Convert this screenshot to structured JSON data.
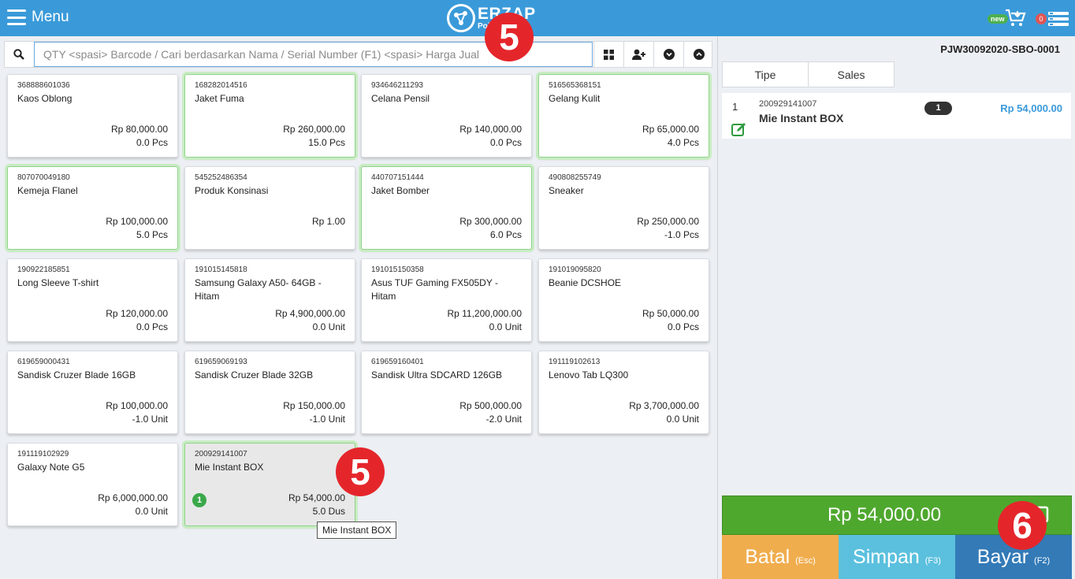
{
  "header": {
    "menu_label": "Menu",
    "brand_name": "ERZAP",
    "brand_sub": "Point of Sales",
    "new_badge": "new",
    "cart_count": "0"
  },
  "search": {
    "placeholder": "QTY <spasi> Barcode / Cari berdasarkan Nama / Serial Number (F1) <spasi> Harga Jual"
  },
  "products": [
    {
      "code": "368888601036",
      "name": "Kaos Oblong",
      "price": "Rp 80,000.00",
      "qty": "0.0 Pcs",
      "state": "normal"
    },
    {
      "code": "168282014516",
      "name": "Jaket Fuma",
      "price": "Rp 260,000.00",
      "qty": "15.0 Pcs",
      "state": "in-stock"
    },
    {
      "code": "934646211293",
      "name": "Celana Pensil",
      "price": "Rp 140,000.00",
      "qty": "0.0 Pcs",
      "state": "normal"
    },
    {
      "code": "516565368151",
      "name": "Gelang Kulit",
      "price": "Rp 65,000.00",
      "qty": "4.0 Pcs",
      "state": "in-stock"
    },
    {
      "code": "807070049180",
      "name": "Kemeja Flanel",
      "price": "Rp 100,000.00",
      "qty": "5.0 Pcs",
      "state": "in-stock"
    },
    {
      "code": "545252486354",
      "name": "Produk Konsinasi",
      "price": "Rp 1.00",
      "qty": "",
      "state": "normal"
    },
    {
      "code": "440707151444",
      "name": "Jaket Bomber",
      "price": "Rp 300,000.00",
      "qty": "6.0 Pcs",
      "state": "in-stock"
    },
    {
      "code": "490808255749",
      "name": "Sneaker",
      "price": "Rp 250,000.00",
      "qty": "-1.0 Pcs",
      "state": "normal"
    },
    {
      "code": "190922185851",
      "name": "Long Sleeve T-shirt",
      "price": "Rp 120,000.00",
      "qty": "0.0 Pcs",
      "state": "normal"
    },
    {
      "code": "191015145818",
      "name": "Samsung Galaxy A50- 64GB - Hitam",
      "price": "Rp 4,900,000.00",
      "qty": "0.0 Unit",
      "state": "normal"
    },
    {
      "code": "191015150358",
      "name": "Asus TUF Gaming FX505DY - Hitam",
      "price": "Rp 11,200,000.00",
      "qty": "0.0 Unit",
      "state": "normal"
    },
    {
      "code": "191019095820",
      "name": "Beanie DCSHOE",
      "price": "Rp 50,000.00",
      "qty": "0.0 Pcs",
      "state": "normal"
    },
    {
      "code": "619659000431",
      "name": "Sandisk Cruzer Blade 16GB",
      "price": "Rp 100,000.00",
      "qty": "-1.0 Unit",
      "state": "normal"
    },
    {
      "code": "619659069193",
      "name": "Sandisk Cruzer Blade 32GB",
      "price": "Rp 150,000.00",
      "qty": "-1.0 Unit",
      "state": "normal"
    },
    {
      "code": "619659160401",
      "name": "Sandisk Ultra SDCARD 126GB",
      "price": "Rp 500,000.00",
      "qty": "-2.0 Unit",
      "state": "normal"
    },
    {
      "code": "191119102613",
      "name": "Lenovo Tab LQ300",
      "price": "Rp 3,700,000.00",
      "qty": "0.0 Unit",
      "state": "normal"
    },
    {
      "code": "191119102929",
      "name": "Galaxy Note G5",
      "price": "Rp 6,000,000.00",
      "qty": "0.0 Unit",
      "state": "normal"
    },
    {
      "code": "200929141007",
      "name": "Mie Instant BOX",
      "price": "Rp 54,000.00",
      "qty": "5.0 Dus",
      "state": "selected",
      "count": "1"
    }
  ],
  "tooltip": "Mie Instant BOX",
  "step_badges": [
    "5",
    "5",
    "6"
  ],
  "panel": {
    "invoice_no": "PJW30092020-SBO-0001",
    "tabs": [
      "Tipe",
      "Sales"
    ],
    "cart_items": [
      {
        "no": "1",
        "code": "200929141007",
        "name": "Mie Instant BOX",
        "qty": "1",
        "price": "Rp 54,000.00"
      }
    ],
    "total": "Rp 54,000.00",
    "buttons": {
      "cancel": {
        "label": "Batal",
        "key": "(Esc)",
        "color": "#f0ad4e"
      },
      "save": {
        "label": "Simpan",
        "key": "(F3)",
        "color": "#5bc0de"
      },
      "pay": {
        "label": "Bayar",
        "key": "(F2)",
        "color": "#337ab7"
      }
    }
  },
  "colors": {
    "header_bg": "#3a9ad9",
    "total_bg": "#4fa82e",
    "step_badge": "#e4262b",
    "in_stock_glow": "#c9ecc4"
  }
}
